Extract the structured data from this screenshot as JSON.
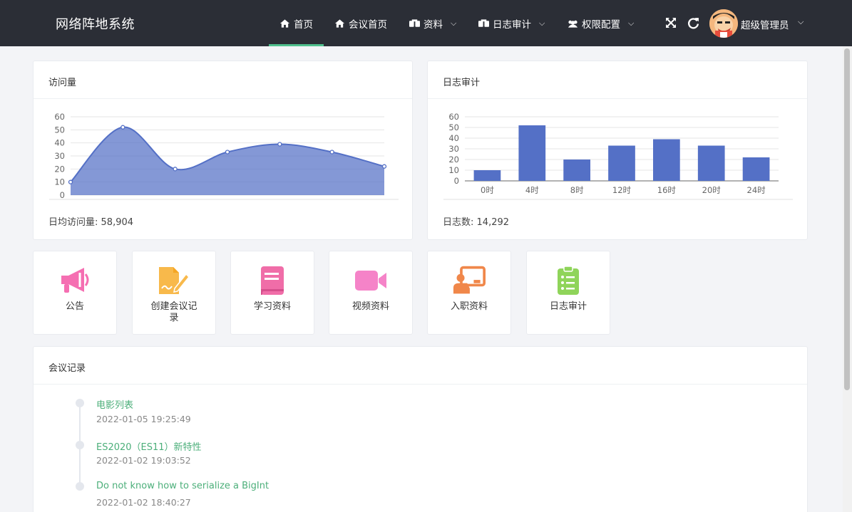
{
  "header": {
    "brand": "网络阵地系统",
    "nav": [
      {
        "label": "首页",
        "icon": "home-icon",
        "active": true
      },
      {
        "label": "会议首页",
        "icon": "home-icon"
      },
      {
        "label": "资料",
        "icon": "boxes-icon",
        "dropdown": true
      },
      {
        "label": "日志审计",
        "icon": "boxes-icon",
        "dropdown": true
      },
      {
        "label": "权限配置",
        "icon": "users-icon",
        "dropdown": true
      }
    ],
    "user": {
      "name": "超级管理员"
    },
    "accent": "#4fc08d"
  },
  "visits_card": {
    "title": "访问量",
    "footer_label": "日均访问量:",
    "footer_value": "58,904"
  },
  "logs_card": {
    "title": "日志审计",
    "footer_label": "日志数:",
    "footer_value": "14,292"
  },
  "chart_data": [
    {
      "type": "area",
      "x": [
        0,
        1,
        2,
        3,
        4,
        5,
        6
      ],
      "values": [
        10,
        52,
        20,
        33,
        39,
        33,
        22
      ],
      "ylim": [
        0,
        60
      ],
      "yticks": [
        "0",
        "10",
        "20",
        "30",
        "40",
        "50",
        "60"
      ],
      "grid": true,
      "color": "#5470c6"
    },
    {
      "type": "bar",
      "categories": [
        "0时",
        "4时",
        "8时",
        "12时",
        "16时",
        "20时",
        "24时"
      ],
      "values": [
        10,
        52,
        20,
        33,
        39,
        33,
        22
      ],
      "ylim": [
        0,
        60
      ],
      "yticks": [
        "0",
        "10",
        "20",
        "30",
        "40",
        "50",
        "60"
      ],
      "grid": true,
      "color": "#5470c6"
    }
  ],
  "tiles": [
    {
      "label": "公告",
      "icon": "megaphone-icon",
      "color": "#f56fb2"
    },
    {
      "label": "创建会议记录",
      "icon": "document-edit-icon",
      "color": "#f8b94b"
    },
    {
      "label": "学习资料",
      "icon": "book-icon",
      "color": "#f06da8"
    },
    {
      "label": "视频资料",
      "icon": "video-camera-icon",
      "color": "#f583c8"
    },
    {
      "label": "入职资料",
      "icon": "teacher-board-icon",
      "color": "#f0874a"
    },
    {
      "label": "日志审计",
      "icon": "clipboard-list-icon",
      "color": "#8fd45a"
    }
  ],
  "meetings": {
    "title": "会议记录",
    "items": [
      {
        "title": "电影列表",
        "time": "2022-01-05 19:25:49"
      },
      {
        "title": "ES2020（ES11）新特性",
        "time": "2022-01-02 19:03:52"
      },
      {
        "title": "Do not know how to serialize a BigInt",
        "time": "2022-01-02 18:40:27"
      }
    ]
  }
}
